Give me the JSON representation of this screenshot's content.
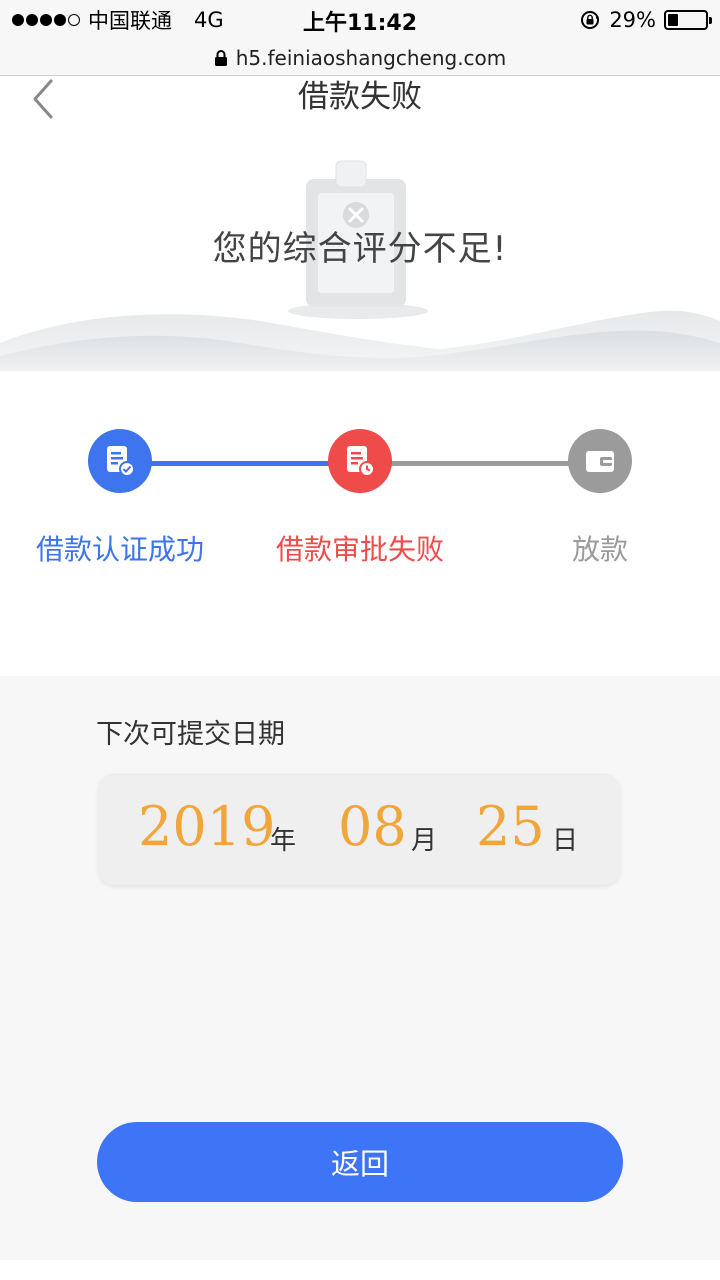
{
  "status_bar": {
    "carrier": "中国联通",
    "network": "4G",
    "time": "上午11:42",
    "battery_percent": "29%",
    "battery_level": 0.29
  },
  "url_bar": {
    "url": "h5.feiniaoshangcheng.com"
  },
  "nav": {
    "title": "借款失败",
    "back_icon": "chevron-left-icon"
  },
  "hero": {
    "message": "您的综合评分不足!",
    "illustration_icon": "rejected-clipboard-icon"
  },
  "progress": {
    "steps": [
      {
        "label": "借款认证成功",
        "status": "done",
        "icon": "document-check-icon",
        "color": "#3e74ee"
      },
      {
        "label": "借款审批失败",
        "status": "failed",
        "icon": "document-clock-icon",
        "color": "#ef4b4b"
      },
      {
        "label": "放款",
        "status": "pending",
        "icon": "wallet-icon",
        "color": "#9b9b9b"
      }
    ]
  },
  "next_submit": {
    "label": "下次可提交日期",
    "year": "2019",
    "year_unit": "年",
    "month": "08",
    "month_unit": "月",
    "day": "25",
    "day_unit": "日"
  },
  "actions": {
    "return_label": "返回"
  },
  "colors": {
    "accent_blue": "#3e74f6",
    "fail_red": "#ef4b4b",
    "pending_gray": "#9b9b9b",
    "date_orange": "#f0a63a"
  }
}
